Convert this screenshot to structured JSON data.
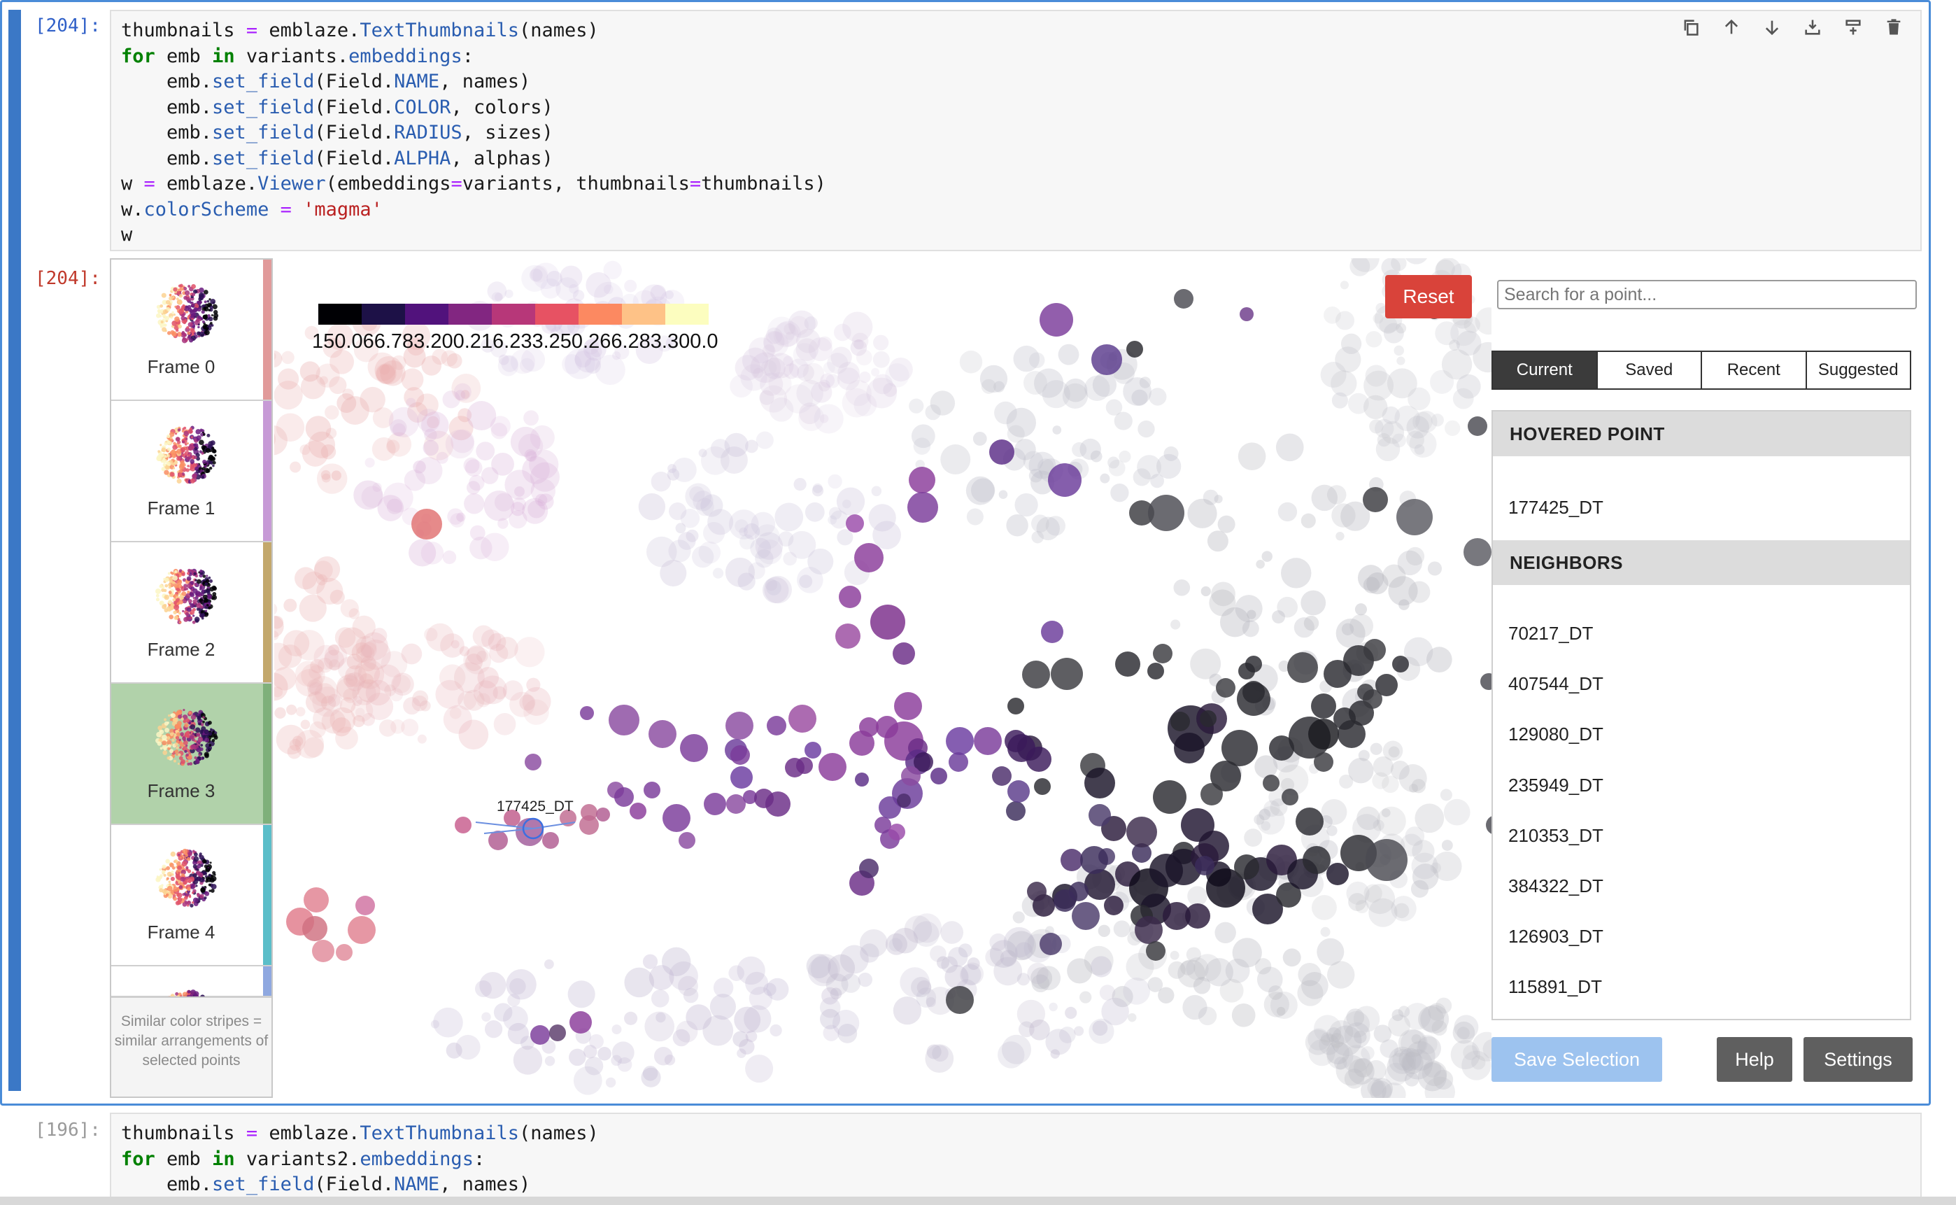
{
  "cells": {
    "input1": {
      "prompt": "[204]:",
      "lines": [
        [
          [
            "thumbnails ",
            ""
          ],
          [
            "=",
            "op"
          ],
          [
            " emblaze.",
            ""
          ],
          [
            "TextThumbnails",
            "fn"
          ],
          [
            "(names)",
            ""
          ]
        ],
        [
          [
            "for",
            "kw"
          ],
          [
            " emb ",
            ""
          ],
          [
            "in",
            "kw"
          ],
          [
            " variants.",
            ""
          ],
          [
            "embeddings",
            "fn"
          ],
          [
            ":",
            ""
          ]
        ],
        [
          [
            "    emb.",
            ""
          ],
          [
            "set_field",
            "fn"
          ],
          [
            "(Field.",
            ""
          ],
          [
            "NAME",
            "fn"
          ],
          [
            ", names)",
            ""
          ]
        ],
        [
          [
            "    emb.",
            ""
          ],
          [
            "set_field",
            "fn"
          ],
          [
            "(Field.",
            ""
          ],
          [
            "COLOR",
            "fn"
          ],
          [
            ", colors)",
            ""
          ]
        ],
        [
          [
            "    emb.",
            ""
          ],
          [
            "set_field",
            "fn"
          ],
          [
            "(Field.",
            ""
          ],
          [
            "RADIUS",
            "fn"
          ],
          [
            ", sizes)",
            ""
          ]
        ],
        [
          [
            "    emb.",
            ""
          ],
          [
            "set_field",
            "fn"
          ],
          [
            "(Field.",
            ""
          ],
          [
            "ALPHA",
            "fn"
          ],
          [
            ", alphas)",
            ""
          ]
        ],
        [
          [
            "w ",
            ""
          ],
          [
            "=",
            "op"
          ],
          [
            " emblaze.",
            ""
          ],
          [
            "Viewer",
            "fn"
          ],
          [
            "(embeddings",
            ""
          ],
          [
            "=",
            "op"
          ],
          [
            "variants, thumbnails",
            ""
          ],
          [
            "=",
            "op"
          ],
          [
            "thumbnails)",
            ""
          ]
        ],
        [
          [
            "w.",
            ""
          ],
          [
            "colorScheme",
            "fn"
          ],
          [
            " ",
            ""
          ],
          [
            "=",
            "op"
          ],
          [
            " ",
            ""
          ],
          [
            "'magma'",
            "str"
          ]
        ],
        [
          [
            "w",
            ""
          ]
        ]
      ]
    },
    "output1": {
      "prompt": "[204]:"
    },
    "input2": {
      "prompt": "[196]:",
      "lines": [
        [
          [
            "thumbnails ",
            ""
          ],
          [
            "=",
            "op"
          ],
          [
            " emblaze.",
            ""
          ],
          [
            "TextThumbnails",
            "fn"
          ],
          [
            "(names)",
            ""
          ]
        ],
        [
          [
            "for",
            "kw"
          ],
          [
            " emb ",
            ""
          ],
          [
            "in",
            "kw"
          ],
          [
            " variants2.",
            ""
          ],
          [
            "embeddings",
            "fn"
          ],
          [
            ":",
            ""
          ]
        ],
        [
          [
            "    emb.",
            ""
          ],
          [
            "set_field",
            "fn"
          ],
          [
            "(Field.",
            ""
          ],
          [
            "NAME",
            "fn"
          ],
          [
            ", names)",
            ""
          ]
        ]
      ]
    }
  },
  "toolbar": [
    "copy-icon",
    "move-up-icon",
    "move-down-icon",
    "insert-below-icon",
    "insert-above-icon",
    "delete-icon"
  ],
  "frames": [
    {
      "label": "Frame 0",
      "stripe": "#e19a9a",
      "selected": false
    },
    {
      "label": "Frame 1",
      "stripe": "#c79ad6",
      "selected": false
    },
    {
      "label": "Frame 2",
      "stripe": "#c3a86c",
      "selected": false
    },
    {
      "label": "Frame 3",
      "stripe": "#7fb07a",
      "selected": true
    },
    {
      "label": "Frame 4",
      "stripe": "#5bbec9",
      "selected": false
    },
    {
      "label": "",
      "stripe": "#8fa8e0",
      "selected": false
    }
  ],
  "hint": "Similar color stripes = similar arrangements of selected points",
  "legend": {
    "colors": [
      "#000004",
      "#1d1147",
      "#51127c",
      "#822681",
      "#b73779",
      "#e75263",
      "#fc8961",
      "#fec287",
      "#fcfdbf"
    ],
    "text": "150.066.783.200.216.233.250.266.283.300.0"
  },
  "hovered_label": "177425_DT",
  "right_panel": {
    "reset_label": "Reset",
    "search_placeholder": "Search for a point...",
    "tabs": [
      "Current",
      "Saved",
      "Recent",
      "Suggested"
    ],
    "active_tab": "Current",
    "hovered_header": "HOVERED POINT",
    "hovered_point": "177425_DT",
    "neighbors_header": "NEIGHBORS",
    "neighbors": [
      "70217_DT",
      "407544_DT",
      "129080_DT",
      "235949_DT",
      "210353_DT",
      "384322_DT",
      "126903_DT",
      "115891_DT"
    ],
    "save_label": "Save Selection",
    "help_label": "Help",
    "settings_label": "Settings"
  }
}
